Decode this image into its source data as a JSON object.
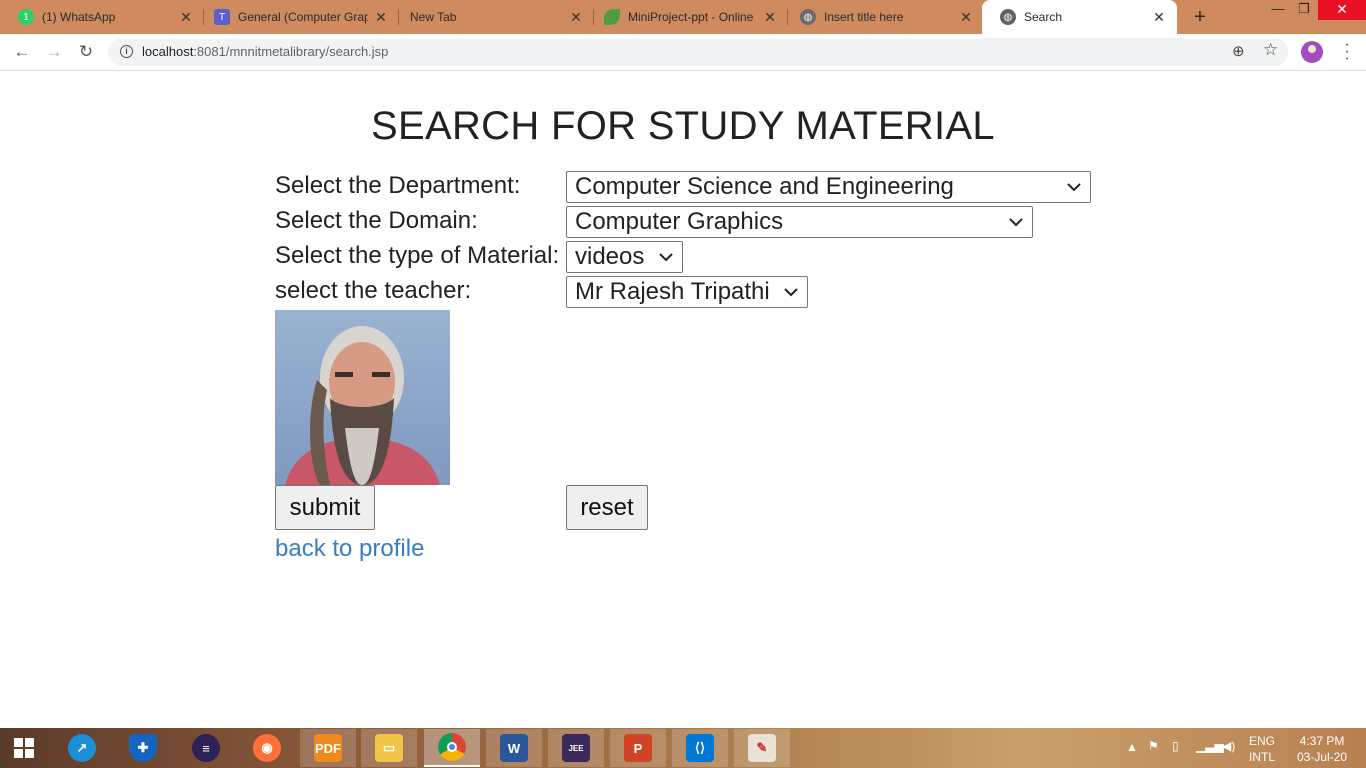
{
  "browser": {
    "tabs": [
      {
        "title": "(1) WhatsApp",
        "icon": "whatsapp-icon"
      },
      {
        "title": "General (Computer Grap",
        "icon": "teams-icon"
      },
      {
        "title": "New Tab",
        "icon": ""
      },
      {
        "title": "MiniProject-ppt - Online",
        "icon": "overleaf-icon"
      },
      {
        "title": "Insert title here",
        "icon": "globe-icon"
      },
      {
        "title": "Search",
        "icon": "globe-icon"
      }
    ],
    "active_tab_index": 5,
    "url_host": "localhost",
    "url_rest": ":8081/mnnitmetalibrary/search.jsp"
  },
  "page": {
    "title": "SEARCH FOR STUDY MATERIAL",
    "department": {
      "label": "Select the Department:",
      "value": "Computer Science and Engineering"
    },
    "domain": {
      "label": "Select the Domain:",
      "value": "Computer Graphics"
    },
    "material": {
      "label": "Select the type of Material:",
      "value": "videos"
    },
    "teacher": {
      "label": "select the teacher:",
      "value": "Mr Rajesh Tripathi"
    },
    "submit_label": "submit",
    "reset_label": "reset",
    "back_link": "back to profile"
  },
  "taskbar": {
    "apps": [
      "start-icon",
      "connection-icon",
      "security-shield-icon",
      "eclipse-icon",
      "firefox-icon",
      "pdf-reader-icon",
      "file-explorer-icon",
      "chrome-icon",
      "word-icon",
      "java-ee-ide-icon",
      "powerpoint-icon",
      "vscode-icon",
      "paint-icon"
    ],
    "active_app": "chrome-icon",
    "lang_line1": "ENG",
    "lang_line2": "INTL",
    "time": "4:37 PM",
    "date": "03-Jul-20"
  },
  "colors": {
    "tabstrip": "#cf8a5d",
    "link": "#3a7ebf",
    "close_button": "#e81123"
  }
}
